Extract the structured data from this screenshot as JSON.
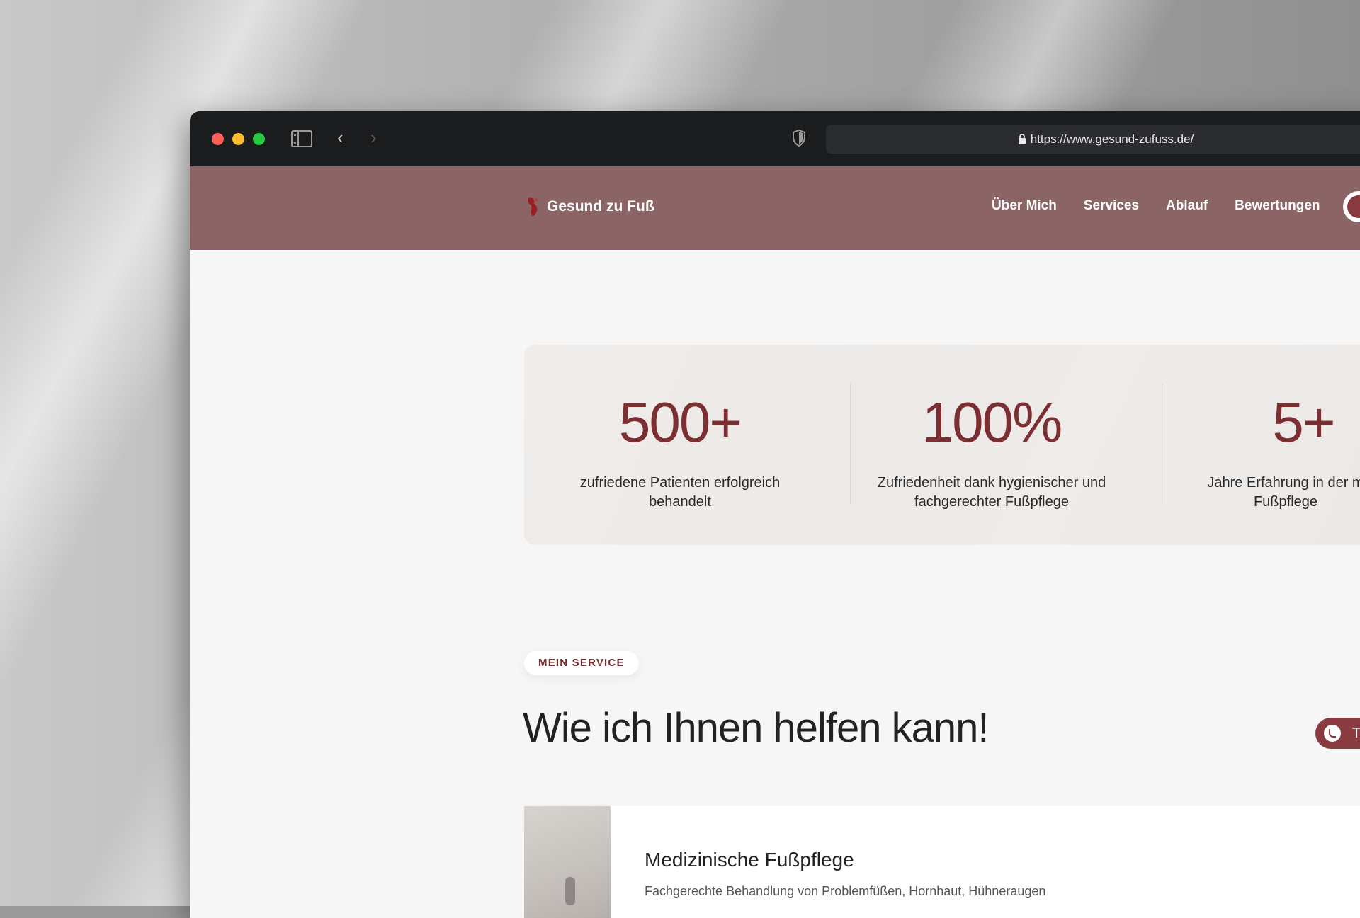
{
  "browser": {
    "url": "https://www.gesund-zufuss.de/"
  },
  "nav": {
    "brand": "Gesund zu Fuß",
    "links": [
      "Über Mich",
      "Services",
      "Ablauf",
      "Bewertungen"
    ]
  },
  "stats": [
    {
      "value": "500+",
      "label": "zufriedene Patienten erfolgreich behandelt"
    },
    {
      "value": "100%",
      "label": "Zufriedenheit dank hygienischer und fachgerechter Fußpflege"
    },
    {
      "value": "5+",
      "label": "Jahre Erfahrung in der m Fußpflege"
    }
  ],
  "section": {
    "badge": "MEIN SERVICE",
    "title": "Wie ich Ihnen helfen kann!"
  },
  "float_call": {
    "label": "T"
  },
  "services": [
    {
      "title": "Medizinische Fußpflege",
      "description": "Fachgerechte Behandlung von Problemfüßen, Hornhaut, Hühneraugen"
    }
  ],
  "colors": {
    "brand": "#7c2f33",
    "nav_bg": "#8b6466",
    "titlebar": "#1b1c1e"
  }
}
